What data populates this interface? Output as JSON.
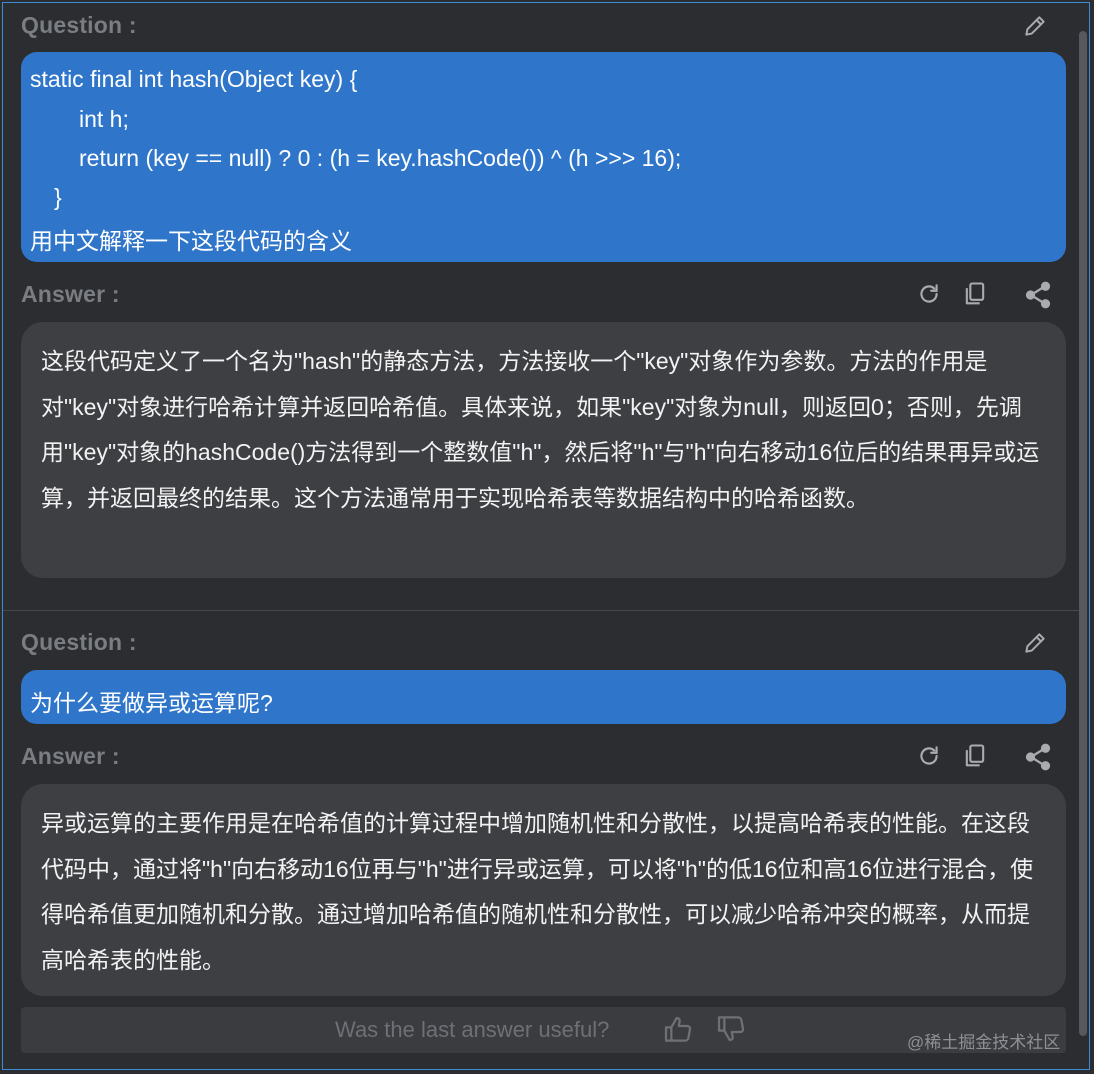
{
  "conversation": [
    {
      "question_label": "Question :",
      "question_lines": [
        "static final int hash(Object key) {",
        "int h;",
        "return (key == null) ? 0 : (h = key.hashCode()) ^ (h >>> 16);",
        "}",
        "用中文解释一下这段代码的含义"
      ],
      "answer_label": "Answer :",
      "answer_text": "这段代码定义了一个名为\"hash\"的静态方法，方法接收一个\"key\"对象作为参数。方法的作用是对\"key\"对象进行哈希计算并返回哈希值。具体来说，如果\"key\"对象为null，则返回0；否则，先调用\"key\"对象的hashCode()方法得到一个整数值\"h\"，然后将\"h\"与\"h\"向右移动16位后的结果再异或运算，并返回最终的结果。这个方法通常用于实现哈希表等数据结构中的哈希函数。"
    },
    {
      "question_label": "Question :",
      "question_lines": [
        "为什么要做异或运算呢?"
      ],
      "answer_label": "Answer :",
      "answer_text": "异或运算的主要作用是在哈希值的计算过程中增加随机性和分散性，以提高哈希表的性能。在这段代码中，通过将\"h\"向右移动16位再与\"h\"进行异或运算，可以将\"h\"的低16位和高16位进行混合，使得哈希值更加随机和分散。通过增加哈希值的随机性和分散性，可以减少哈希冲突的概率，从而提高哈希表的性能。"
    }
  ],
  "feedback": {
    "prompt": "Was the last answer useful?",
    "thumbs_up_icon": "thumbs-up-icon",
    "thumbs_down_icon": "thumbs-down-icon"
  },
  "watermark": "@稀土掘金技术社区",
  "icons": {
    "edit": "pencil-icon",
    "regenerate": "refresh-icon",
    "copy": "copy-icon",
    "share": "share-icon"
  },
  "colors": {
    "background": "#2b2d30",
    "question_bubble": "#2f76cb",
    "answer_bubble": "#3d3f43",
    "label": "#7a7d82",
    "frame_border": "#3d8ad9"
  }
}
